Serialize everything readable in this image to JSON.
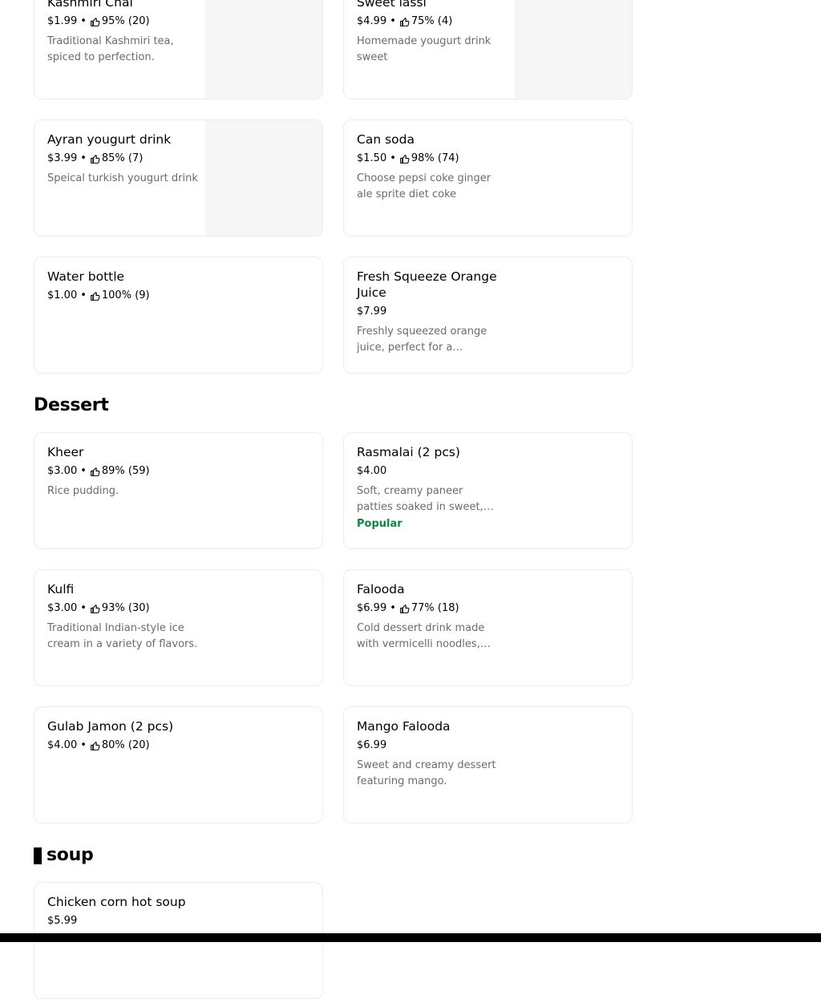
{
  "sections": {
    "dessert_title": "Dessert",
    "soup_title": "soup"
  },
  "drinks": [
    {
      "name": "Kashmiri Chai",
      "price": "$1.99",
      "rating": "95% (20)",
      "desc": "Traditional Kashmiri tea, spiced to perfection."
    },
    {
      "name": "Sweet lassi",
      "price": "$4.99",
      "rating": "75% (4)",
      "desc": "Homemade yougurt drink sweet"
    },
    {
      "name": "Ayran yougurt drink",
      "price": "$3.99",
      "rating": "85% (7)",
      "desc": "Speical turkish yougurt drink"
    },
    {
      "name": "Can soda",
      "price": "$1.50",
      "rating": "98% (74)",
      "desc": "Choose pepsi coke ginger ale sprite diet coke"
    },
    {
      "name": "Water bottle",
      "price": "$1.00",
      "rating": "100% (9)"
    },
    {
      "name": "Fresh Squeeze Orange Juice",
      "price": "$7.99",
      "desc": "Freshly squeezed orange juice, perfect for a refreshing start to your day."
    }
  ],
  "desserts": [
    {
      "name": "Kheer",
      "price": "$3.00",
      "rating": "89% (59)",
      "desc": "Rice pudding."
    },
    {
      "name": "Rasmalai (2 pcs)",
      "price": "$4.00",
      "desc": "Soft, creamy paneer patties soaked in sweet, creamy milk.",
      "badge": "Popular"
    },
    {
      "name": "Kulfi",
      "price": "$3.00",
      "rating": "93% (30)",
      "desc": "Traditional Indian-style ice cream in a variety of flavors."
    },
    {
      "name": "Falooda",
      "price": "$6.99",
      "rating": "77% (18)",
      "desc": "Cold dessert drink made with vermicelli noodles, basil seeds and milk."
    },
    {
      "name": "Gulab Jamon (2 pcs)",
      "price": "$4.00",
      "rating": "80% (20)"
    },
    {
      "name": "Mango Falooda",
      "price": "$6.99",
      "desc": "Sweet and creamy dessert featuring mango."
    }
  ],
  "soup": [
    {
      "name": "Chicken corn hot soup",
      "price": "$5.99"
    }
  ],
  "icons": {
    "rating": "thumbs-up-icon"
  },
  "colors": {
    "badge": "#0e8345",
    "muted_text": "#6b6b6b",
    "card_border": "#ececec"
  }
}
